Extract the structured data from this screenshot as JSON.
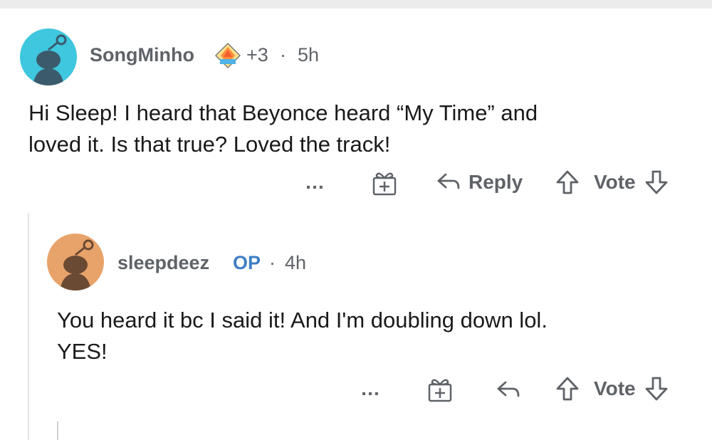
{
  "comment1": {
    "username": "SongMinho",
    "award_extra": "+3",
    "separator": "·",
    "time": "5h",
    "text_lines": [
      "Hi Sleep! I heard that Beyonce heard “My Time” and",
      "loved it. Is that true? Loved the track!"
    ],
    "actions": {
      "more": "…",
      "reply": "Reply",
      "vote": "Vote"
    },
    "avatar_color": "#3ec7de"
  },
  "comment2": {
    "username": "sleepdeez",
    "op_badge": "OP",
    "separator": "·",
    "time": "4h",
    "text_lines": [
      "You heard it bc I said it! And I'm doubling down lol.",
      "YES!"
    ],
    "actions": {
      "more": "…",
      "vote": "Vote"
    },
    "avatar_color": "#e8a36a"
  },
  "colors": {
    "muted_text": "#5f6368",
    "op_blue": "#3f7fc4",
    "thread_line": "#e3e3e3"
  }
}
